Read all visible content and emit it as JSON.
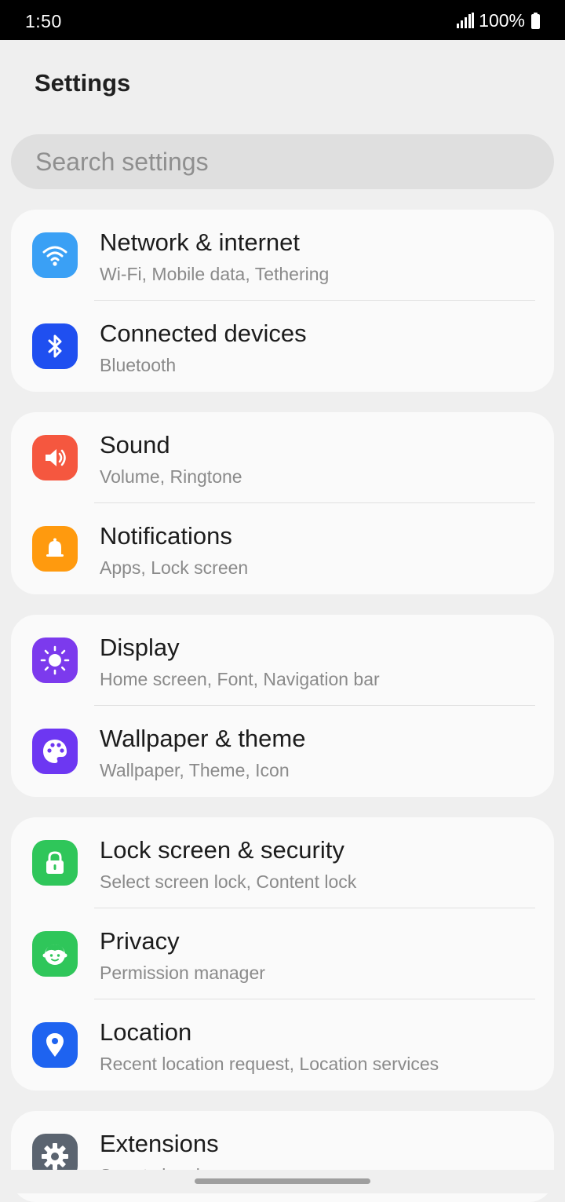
{
  "status_bar": {
    "time": "1:50",
    "battery": "100%"
  },
  "title": "Settings",
  "search": {
    "placeholder": "Search settings"
  },
  "groups": [
    {
      "items": [
        {
          "label": "Network & internet",
          "sub": "Wi-Fi, Mobile data, Tethering",
          "icon": "wifi-icon",
          "color": "#3aa0f5"
        },
        {
          "label": "Connected devices",
          "sub": "Bluetooth",
          "icon": "bluetooth-icon",
          "color": "#1f4ff0"
        }
      ]
    },
    {
      "items": [
        {
          "label": "Sound",
          "sub": "Volume, Ringtone",
          "icon": "speaker-icon",
          "color": "#f5573f"
        },
        {
          "label": "Notifications",
          "sub": "Apps, Lock screen",
          "icon": "bell-icon",
          "color": "#ff9a0e"
        }
      ]
    },
    {
      "items": [
        {
          "label": "Display",
          "sub": "Home screen, Font, Navigation bar",
          "icon": "brightness-icon",
          "color": "#7c3aed"
        },
        {
          "label": "Wallpaper & theme",
          "sub": "Wallpaper, Theme, Icon",
          "icon": "palette-icon",
          "color": "#6d37f2"
        }
      ]
    },
    {
      "items": [
        {
          "label": "Lock screen & security",
          "sub": "Select screen lock, Content lock",
          "icon": "lock-icon",
          "color": "#2fc65a"
        },
        {
          "label": "Privacy",
          "sub": "Permission manager",
          "icon": "privacy-face-icon",
          "color": "#2fc65a"
        },
        {
          "label": "Location",
          "sub": "Recent location request, Location services",
          "icon": "location-pin-icon",
          "color": "#1e63f0"
        }
      ]
    },
    {
      "items": [
        {
          "label": "Extensions",
          "sub": "Smart sleeping",
          "icon": "gear-icon",
          "color": "#5b6470"
        }
      ]
    }
  ]
}
